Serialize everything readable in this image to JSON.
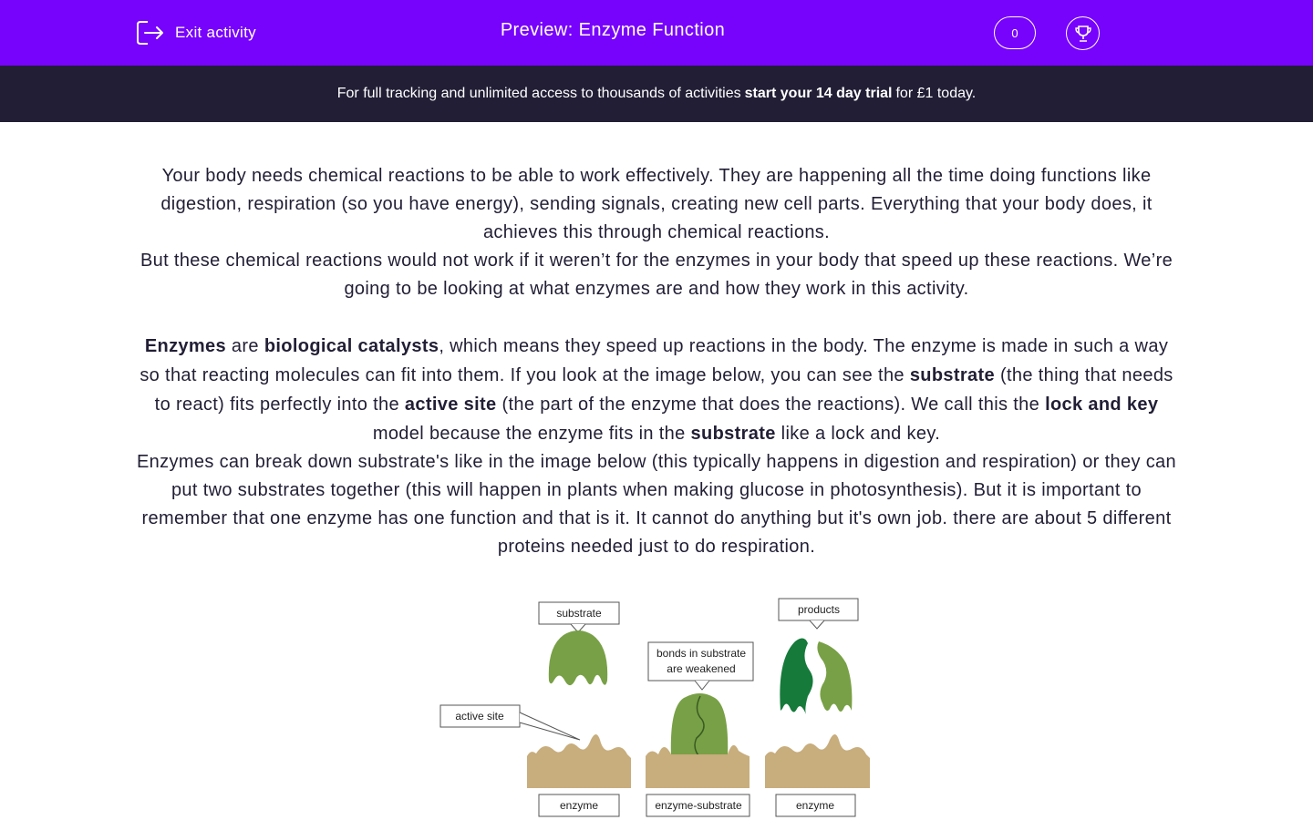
{
  "header": {
    "exit_label": "Exit activity",
    "title": "Preview: Enzyme Function",
    "score": "0",
    "icons": {
      "exit": "exit-door-icon",
      "trophy": "trophy-icon"
    },
    "color": "#7703fc"
  },
  "banner": {
    "text_before": "For full tracking and unlimited access to thousands of activities",
    "cta": "start your 14 day trial",
    "text_after": "for £1 today.",
    "color": "#221e35"
  },
  "content": {
    "para1": [
      "Your body needs chemical reactions to be able to work effectively. They are happening all the time doing functions like digestion, respiration (so you have energy), sending signals, creating new cell parts. Everything that your body does, it achieves this through chemical reactions.",
      "But these chemical reactions would not work if it weren’t for the enzymes in your body that speed up these reactions. We’re going to be looking at what enzymes are and how they work in this activity."
    ],
    "para2": {
      "enzymes": "Enzymes",
      "are": "are",
      "biological_catalysts": "biological catalysts",
      "t1": ", which means they speed up reactions in the body. The enzyme is made in such a way so that reacting molecules can fit into them. If you look at the image below, you can see the",
      "substrate": "substrate",
      "t2": "(the thing that needs to react) fits perfectly into the",
      "active_site": "active site",
      "t3": "(the part of the enzyme that does the reactions). We call this the",
      "lock_and_key": "lock and key",
      "t4": "model because the enzyme fits in the",
      "substrate2": "substrate",
      "t5": "like a lock and key."
    },
    "para3": "Enzymes can break down substrate's like in the image below (this typically happens in digestion and respiration) or they can put two substrates together (this will happen in plants when making glucose in photosynthesis). But it is important to remember that one enzyme has one function and that is it. It cannot do anything but it's own job. there are about 5 different proteins needed just to do respiration."
  },
  "figure": {
    "labels": {
      "substrate": "substrate",
      "products": "products",
      "bonds_line1": "bonds in substrate",
      "bonds_line2": "are weakened",
      "active_site": "active site",
      "enzyme1": "enzyme",
      "enzyme_substrate": "enzyme-substrate",
      "enzyme2": "enzyme"
    },
    "colors": {
      "substrate": "#78a046",
      "product_dark": "#157a3a",
      "enzyme": "#c8ad7d"
    }
  }
}
